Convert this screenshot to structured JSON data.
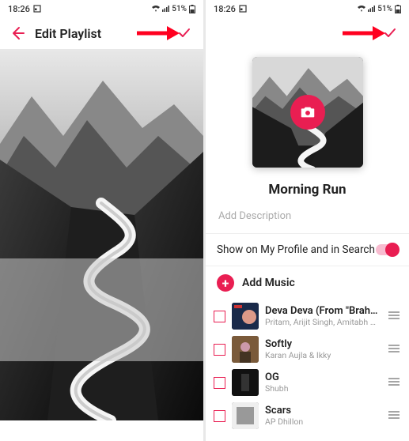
{
  "status": {
    "time": "18:26",
    "battery": "51%"
  },
  "left": {
    "title": "Edit Playlist"
  },
  "right": {
    "playlist_title": "Morning Run",
    "description_placeholder": "Add Description",
    "toggle_label": "Show on My Profile and in Search",
    "add_music_label": "Add Music",
    "tracks": [
      {
        "title": "Deva Deva (From \"Brah…",
        "subtitle": "Pritam, Arijit Singh, Amitabh Bha…"
      },
      {
        "title": "Softly",
        "subtitle": "Karan Aujla & Ikky"
      },
      {
        "title": "OG",
        "subtitle": "Shubh"
      },
      {
        "title": "Scars",
        "subtitle": "AP Dhillon"
      }
    ]
  }
}
